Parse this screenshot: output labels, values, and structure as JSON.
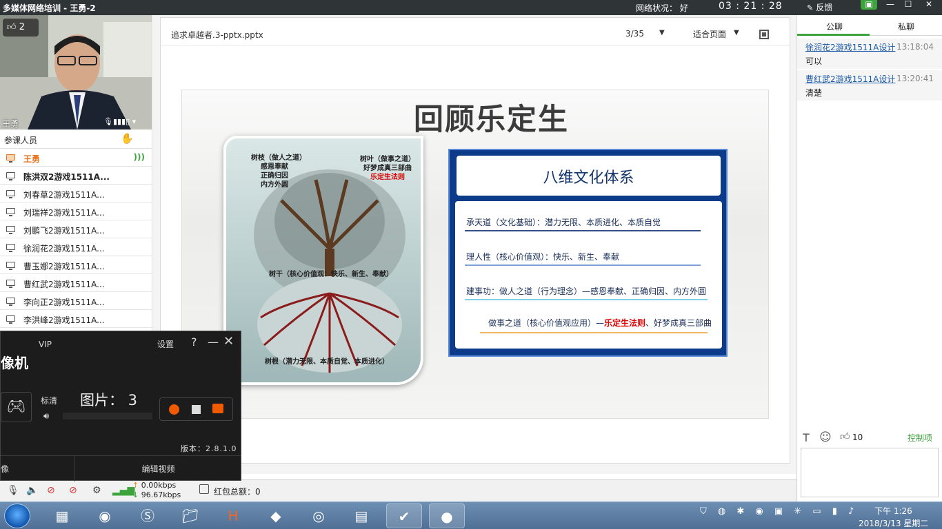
{
  "window": {
    "title": "多媒体网络培训 - 王勇-2",
    "network_label": "网络状况：",
    "network_value": "好",
    "timer": "03 : 21 : 28",
    "feedback_label": "反馈"
  },
  "video": {
    "likes": "2",
    "speaker_name": "王勇"
  },
  "participants": {
    "header": "参课人员",
    "items": [
      {
        "name": "王勇",
        "role": "host"
      },
      {
        "name": "陈洪双2游戏1511A...",
        "role": "bold"
      },
      {
        "name": "刘春草2游戏1511A...",
        "role": "normal"
      },
      {
        "name": "刘瑞祥2游戏1511A...",
        "role": "normal"
      },
      {
        "name": "刘鹏飞2游戏1511A...",
        "role": "normal"
      },
      {
        "name": "徐润花2游戏1511A...",
        "role": "normal"
      },
      {
        "name": "曹玉娜2游戏1511A...",
        "role": "normal"
      },
      {
        "name": "曹红武2游戏1511A...",
        "role": "normal"
      },
      {
        "name": "李向正2游戏1511A...",
        "role": "normal"
      },
      {
        "name": "李洪峰2游戏1511A...",
        "role": "normal"
      }
    ]
  },
  "document": {
    "filename": "追求卓越者.3-pptx.pptx",
    "page_indicator": "3/35",
    "fit_mode": "适合页面"
  },
  "slide": {
    "title": "回顾乐定生",
    "tree": {
      "branches": [
        "树枝（做人之道）",
        "感恩奉献",
        "正确归因",
        "内方外圆"
      ],
      "leaves": [
        "树叶（做事之道）",
        "好梦成真三部曲"
      ],
      "leaves_red": "乐定生法则",
      "trunk": "树干（核心价值观：快乐、新生、奉献）",
      "roots": "树根（潜力无限、本质自觉、本质进化）"
    },
    "culture": {
      "title": "八维文化体系",
      "lines": [
        "承天道（文化基础）：潜力无限、本质进化、本质自觉",
        "理人性（核心价值观）：快乐、新生、奉献",
        "建事功：做人之道（行为理念）—感恩奉献、正确归因、内方外圆"
      ],
      "line4_prefix": "做事之道（核心价值观应用）—",
      "line4_red": "乐定生法则",
      "line4_suffix": "、好梦成真三部曲"
    }
  },
  "chat": {
    "tab_public": "公聊",
    "tab_private": "私聊",
    "messages": [
      {
        "sender": "徐润花2游戏1511A设计",
        "time": "13:18:04",
        "text": "可以"
      },
      {
        "sender": "曹红武2游戏1511A设计",
        "time": "13:20:41",
        "text": "清楚"
      }
    ],
    "like_count": "10",
    "control_label": "控制项"
  },
  "statusbar": {
    "upload": "0.00kbps",
    "download": "96.67kbps",
    "redpack_label": "红包总额：0"
  },
  "recorder": {
    "vip": "VIP",
    "title": "像机",
    "settings": "设置",
    "quality": "标清",
    "photo_count": "图片： 3",
    "version": "版本：2.8.1.0",
    "footer_left": "像",
    "footer_right": "编辑视频"
  },
  "taskbar": {
    "time": "下午 1:26",
    "date": "2018/3/13 星期二"
  }
}
